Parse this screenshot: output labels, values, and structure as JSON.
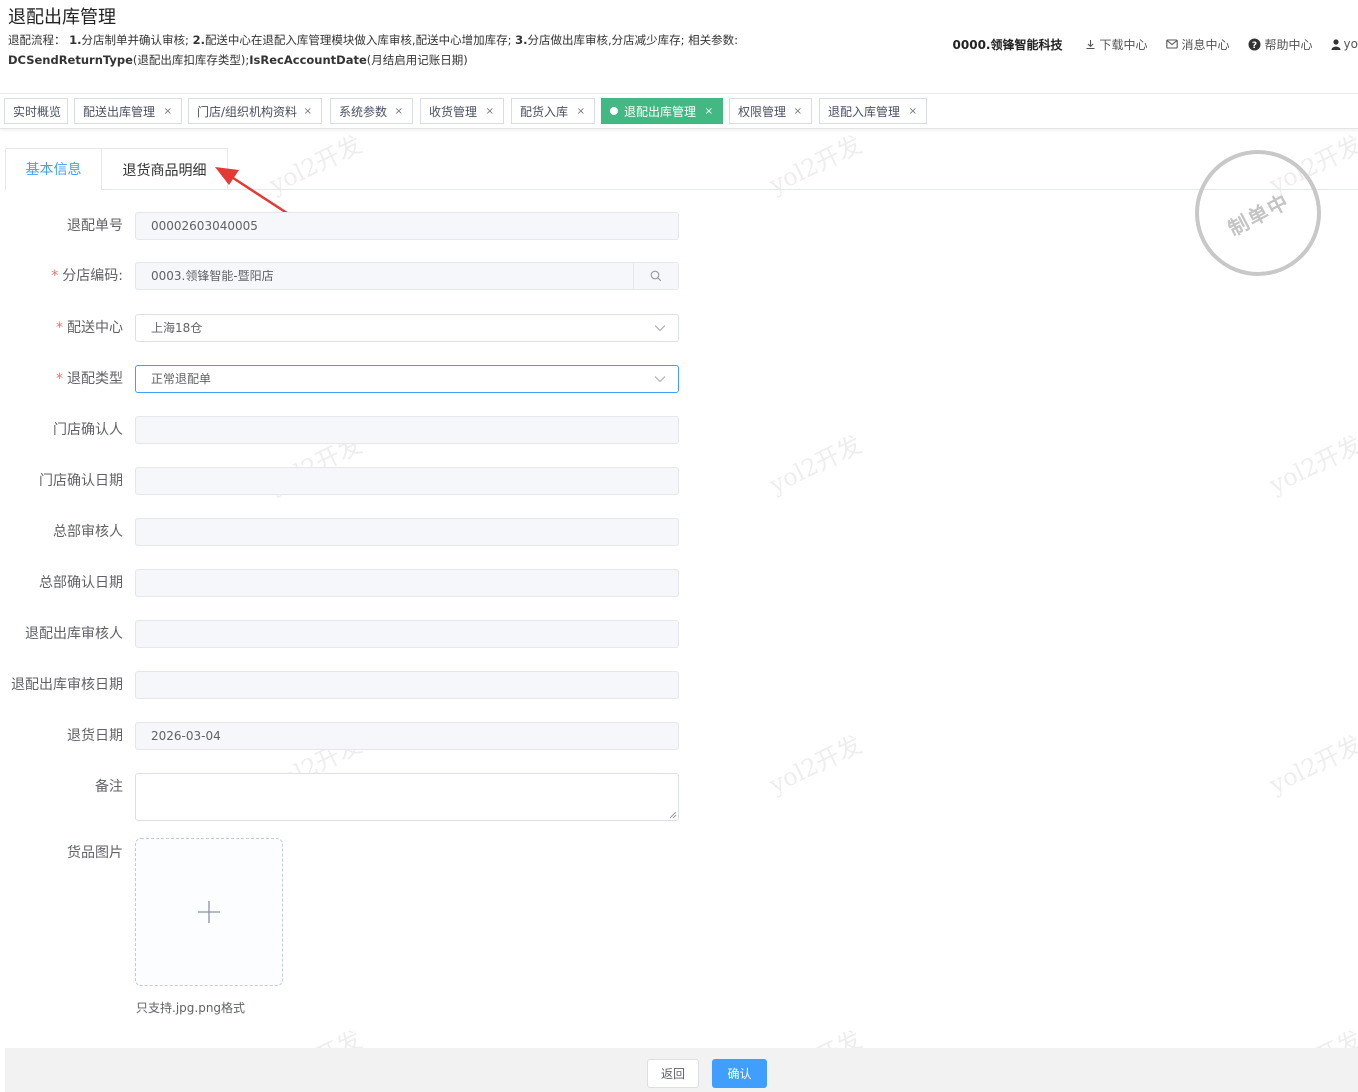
{
  "header": {
    "title": "退配出库管理",
    "desc_label": "退配流程：",
    "desc_part1": "1.",
    "desc_part2": "分店制单并确认审核; ",
    "desc_part3": "2.",
    "desc_part4": "配送中心在退配入库管理模块做入库审核,配送中心增加库存; ",
    "desc_part5": "3.",
    "desc_part6": "分店做出库审核,分店减少库存; 相关参数: ",
    "desc_param1": "DCSendReturnType",
    "desc_param1_note": "(退配出库扣库存类型);",
    "desc_param2": "IsRecAccountDate",
    "desc_param2_note": "(月结启用记账日期)"
  },
  "topnav": {
    "company": "0000.领锋智能科技",
    "download": "下载中心",
    "message": "消息中心",
    "help": "帮助中心",
    "user": "yo"
  },
  "tags": [
    {
      "label": "实时概览"
    },
    {
      "label": "配送出库管理"
    },
    {
      "label": "门店/组织机构资料"
    },
    {
      "label": "系统参数"
    },
    {
      "label": "收货管理"
    },
    {
      "label": "配货入库"
    },
    {
      "label": "退配出库管理"
    },
    {
      "label": "权限管理"
    },
    {
      "label": "退配入库管理"
    }
  ],
  "tab_close": "×",
  "inner_tabs": {
    "basic": "基本信息",
    "detail": "退货商品明细"
  },
  "stamp": "制单中",
  "watermark": "yol2开发",
  "form": {
    "order_no": {
      "label": "退配单号",
      "value": "00002603040005"
    },
    "store_code": {
      "label": "分店编码:",
      "value": "0003.领锋智能-暨阳店",
      "required": "*"
    },
    "dc": {
      "label": "配送中心",
      "value": "上海18仓",
      "required": "*"
    },
    "return_type": {
      "label": "退配类型",
      "value": "正常退配单",
      "required": "*"
    },
    "store_confirmer": {
      "label": "门店确认人",
      "value": ""
    },
    "store_confirm_date": {
      "label": "门店确认日期",
      "value": ""
    },
    "hq_auditor": {
      "label": "总部审核人",
      "value": ""
    },
    "hq_confirm_date": {
      "label": "总部确认日期",
      "value": ""
    },
    "out_auditor": {
      "label": "退配出库审核人",
      "value": ""
    },
    "out_audit_date": {
      "label": "退配出库审核日期",
      "value": ""
    },
    "return_date": {
      "label": "退货日期",
      "value": "2026-03-04"
    },
    "remark": {
      "label": "备注",
      "value": ""
    },
    "goods_image": {
      "label": "货品图片",
      "hint": "只支持.jpg.png格式"
    }
  },
  "footer": {
    "back": "返回",
    "confirm": "确认"
  },
  "colors": {
    "primary": "#409eff",
    "active_tag": "#42b983",
    "required": "#f56c6c"
  }
}
